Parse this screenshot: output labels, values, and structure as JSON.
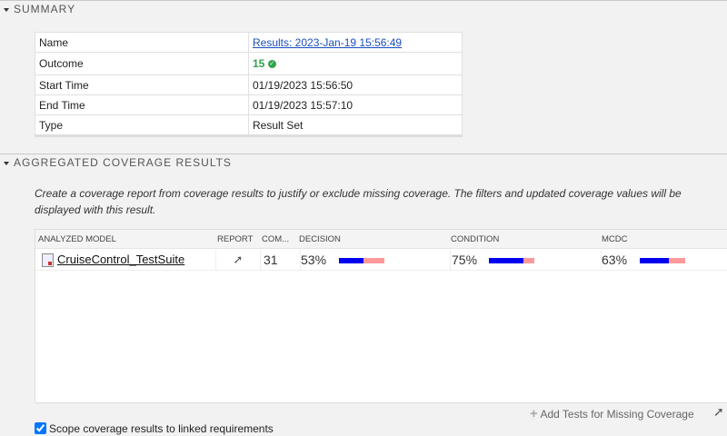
{
  "summary": {
    "title": "SUMMARY",
    "rows": [
      {
        "label": "Name",
        "value": "Results: 2023-Jan-19 15:56:49"
      },
      {
        "label": "Outcome",
        "value": "15"
      },
      {
        "label": "Start Time",
        "value": "01/19/2023 15:56:50"
      },
      {
        "label": "End Time",
        "value": "01/19/2023 15:57:10"
      },
      {
        "label": "Type",
        "value": "Result Set"
      }
    ]
  },
  "coverage": {
    "title": "AGGREGATED COVERAGE RESULTS",
    "description": "Create a coverage report from coverage results to justify or exclude missing coverage. The filters and updated coverage values will be displayed with this result.",
    "columns": [
      "ANALYZED MODEL",
      "REPORT",
      "COM...",
      "DECISION",
      "CONDITION",
      "MCDC"
    ],
    "row": {
      "model": "CruiseControl_TestSuite",
      "complexity": "31",
      "decision": "53%",
      "condition": "75%",
      "mcdc": "63%"
    },
    "percents": {
      "decision": 53,
      "condition": 75,
      "mcdc": 63
    },
    "colors": {
      "covered": "#0000f0",
      "missing": "#ff9999"
    },
    "add_tests_label": "Add Tests for Missing Coverage",
    "scope_label": "Scope coverage results to linked requirements",
    "scope_checked": true
  }
}
